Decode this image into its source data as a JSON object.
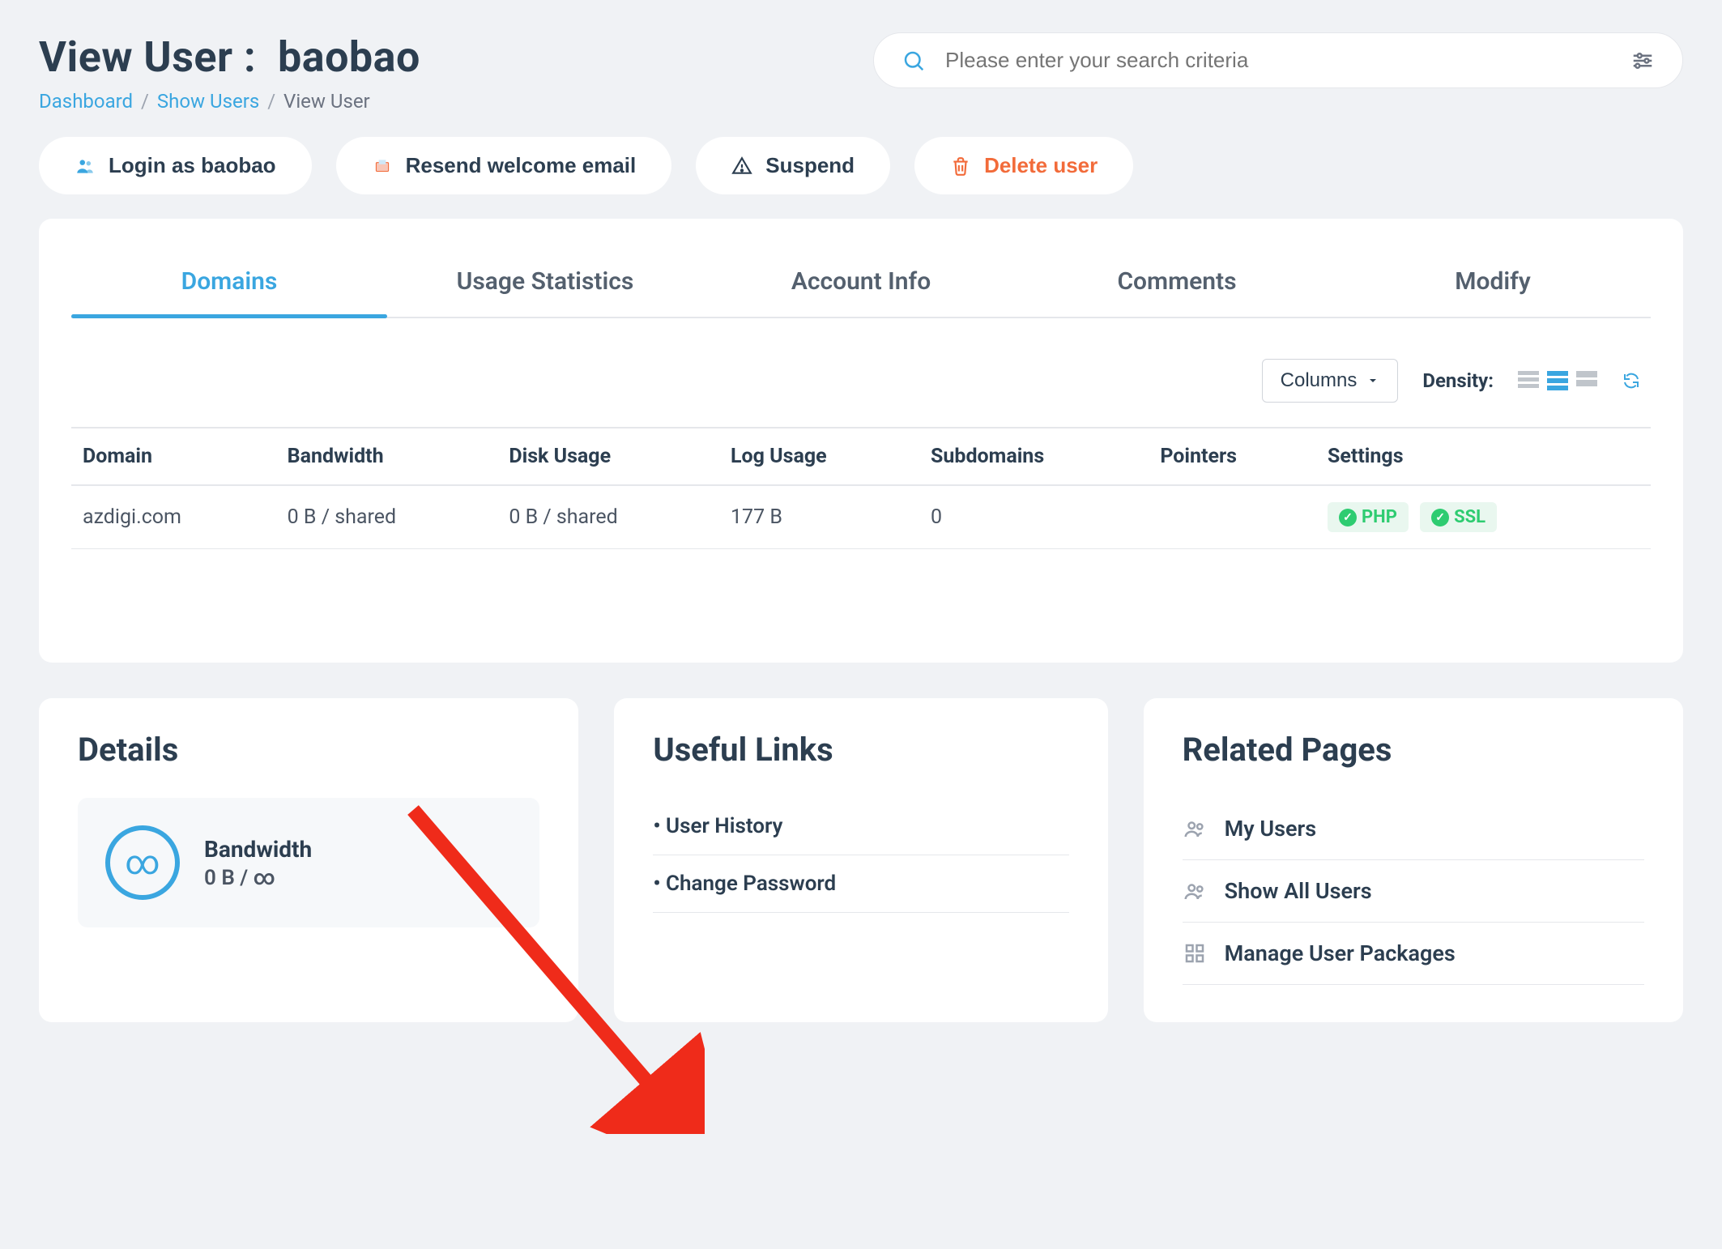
{
  "title_label": "View User :",
  "username": "baobao",
  "breadcrumb": {
    "dashboard": "Dashboard",
    "show_users": "Show Users",
    "current": "View User"
  },
  "search": {
    "placeholder": "Please enter your search criteria"
  },
  "actions": {
    "login_as": "Login as baobao",
    "resend": "Resend welcome email",
    "suspend": "Suspend",
    "delete": "Delete user"
  },
  "tabs": [
    "Domains",
    "Usage Statistics",
    "Account Info",
    "Comments",
    "Modify"
  ],
  "toolbar": {
    "columns": "Columns",
    "density": "Density:"
  },
  "table": {
    "headers": [
      "Domain",
      "Bandwidth",
      "Disk Usage",
      "Log Usage",
      "Subdomains",
      "Pointers",
      "Settings"
    ],
    "rows": [
      {
        "domain": "azdigi.com",
        "bandwidth": "0 B / shared",
        "disk": "0 B / shared",
        "log": "177 B",
        "subdomains": "0",
        "pointers": "",
        "settings": [
          "PHP",
          "SSL"
        ]
      }
    ]
  },
  "details": {
    "heading": "Details",
    "bandwidth_label": "Bandwidth",
    "bandwidth_value": "0 B / ∞"
  },
  "useful_links": {
    "heading": "Useful Links",
    "items": [
      "User History",
      "Change Password"
    ]
  },
  "related_pages": {
    "heading": "Related Pages",
    "items": [
      "My Users",
      "Show All Users",
      "Manage User Packages"
    ]
  }
}
